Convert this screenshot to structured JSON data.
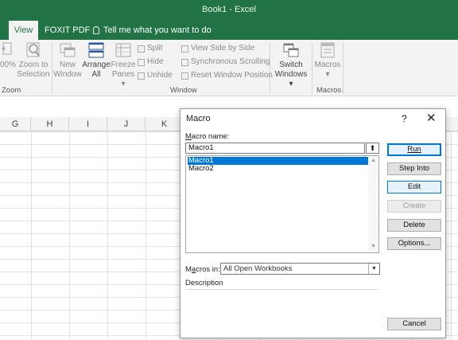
{
  "window": {
    "title": "Book1  -  Excel"
  },
  "tabs": [
    {
      "label": "View",
      "active": true
    },
    {
      "label": "FOXIT PDF",
      "active": false
    }
  ],
  "tell_me": "Tell me what you want to do",
  "ribbon": {
    "zoom_group": {
      "pct_label": "00%",
      "zoom_to_selection": [
        "Zoom to",
        "Selection"
      ],
      "label": "Zoom"
    },
    "window_group": {
      "new_window": [
        "New",
        "Window"
      ],
      "arrange_all": [
        "Arrange",
        "All"
      ],
      "freeze_panes": [
        "Freeze",
        "Panes ▾"
      ],
      "split": "Split",
      "hide": "Hide",
      "unhide": "Unhide",
      "view_side_by_side": "View Side by Side",
      "sync_scrolling": "Synchronous Scrolling",
      "reset_window_position": "Reset Window Position",
      "switch_windows": [
        "Switch",
        "Windows ▾"
      ],
      "label": "Window"
    },
    "macros_group": {
      "macros": [
        "Macros",
        "▾"
      ],
      "label": "Macros"
    }
  },
  "columns": [
    "G",
    "H",
    "I",
    "J",
    "K"
  ],
  "dialog": {
    "title": "Macro",
    "help": "?",
    "close": "✕",
    "macro_name_label_pre": "M",
    "macro_name_label_rest": "acro name:",
    "macro_name_value": "Macro1",
    "macro_list": [
      "Macro1",
      "Macro2"
    ],
    "selected_macro": "Macro1",
    "macros_in_label_pre": "M",
    "macros_in_label_mid": "a",
    "macros_in_label_rest": "cros in:",
    "macros_in_value": "All Open Workbooks",
    "description_label": "Description",
    "buttons": {
      "run": "Run",
      "step_into": "Step Into",
      "edit": "Edit",
      "create": "Create",
      "delete": "Delete",
      "options": "Options...",
      "cancel": "Cancel"
    }
  },
  "colors": {
    "accent": "#217346",
    "selection": "#0078d7"
  }
}
